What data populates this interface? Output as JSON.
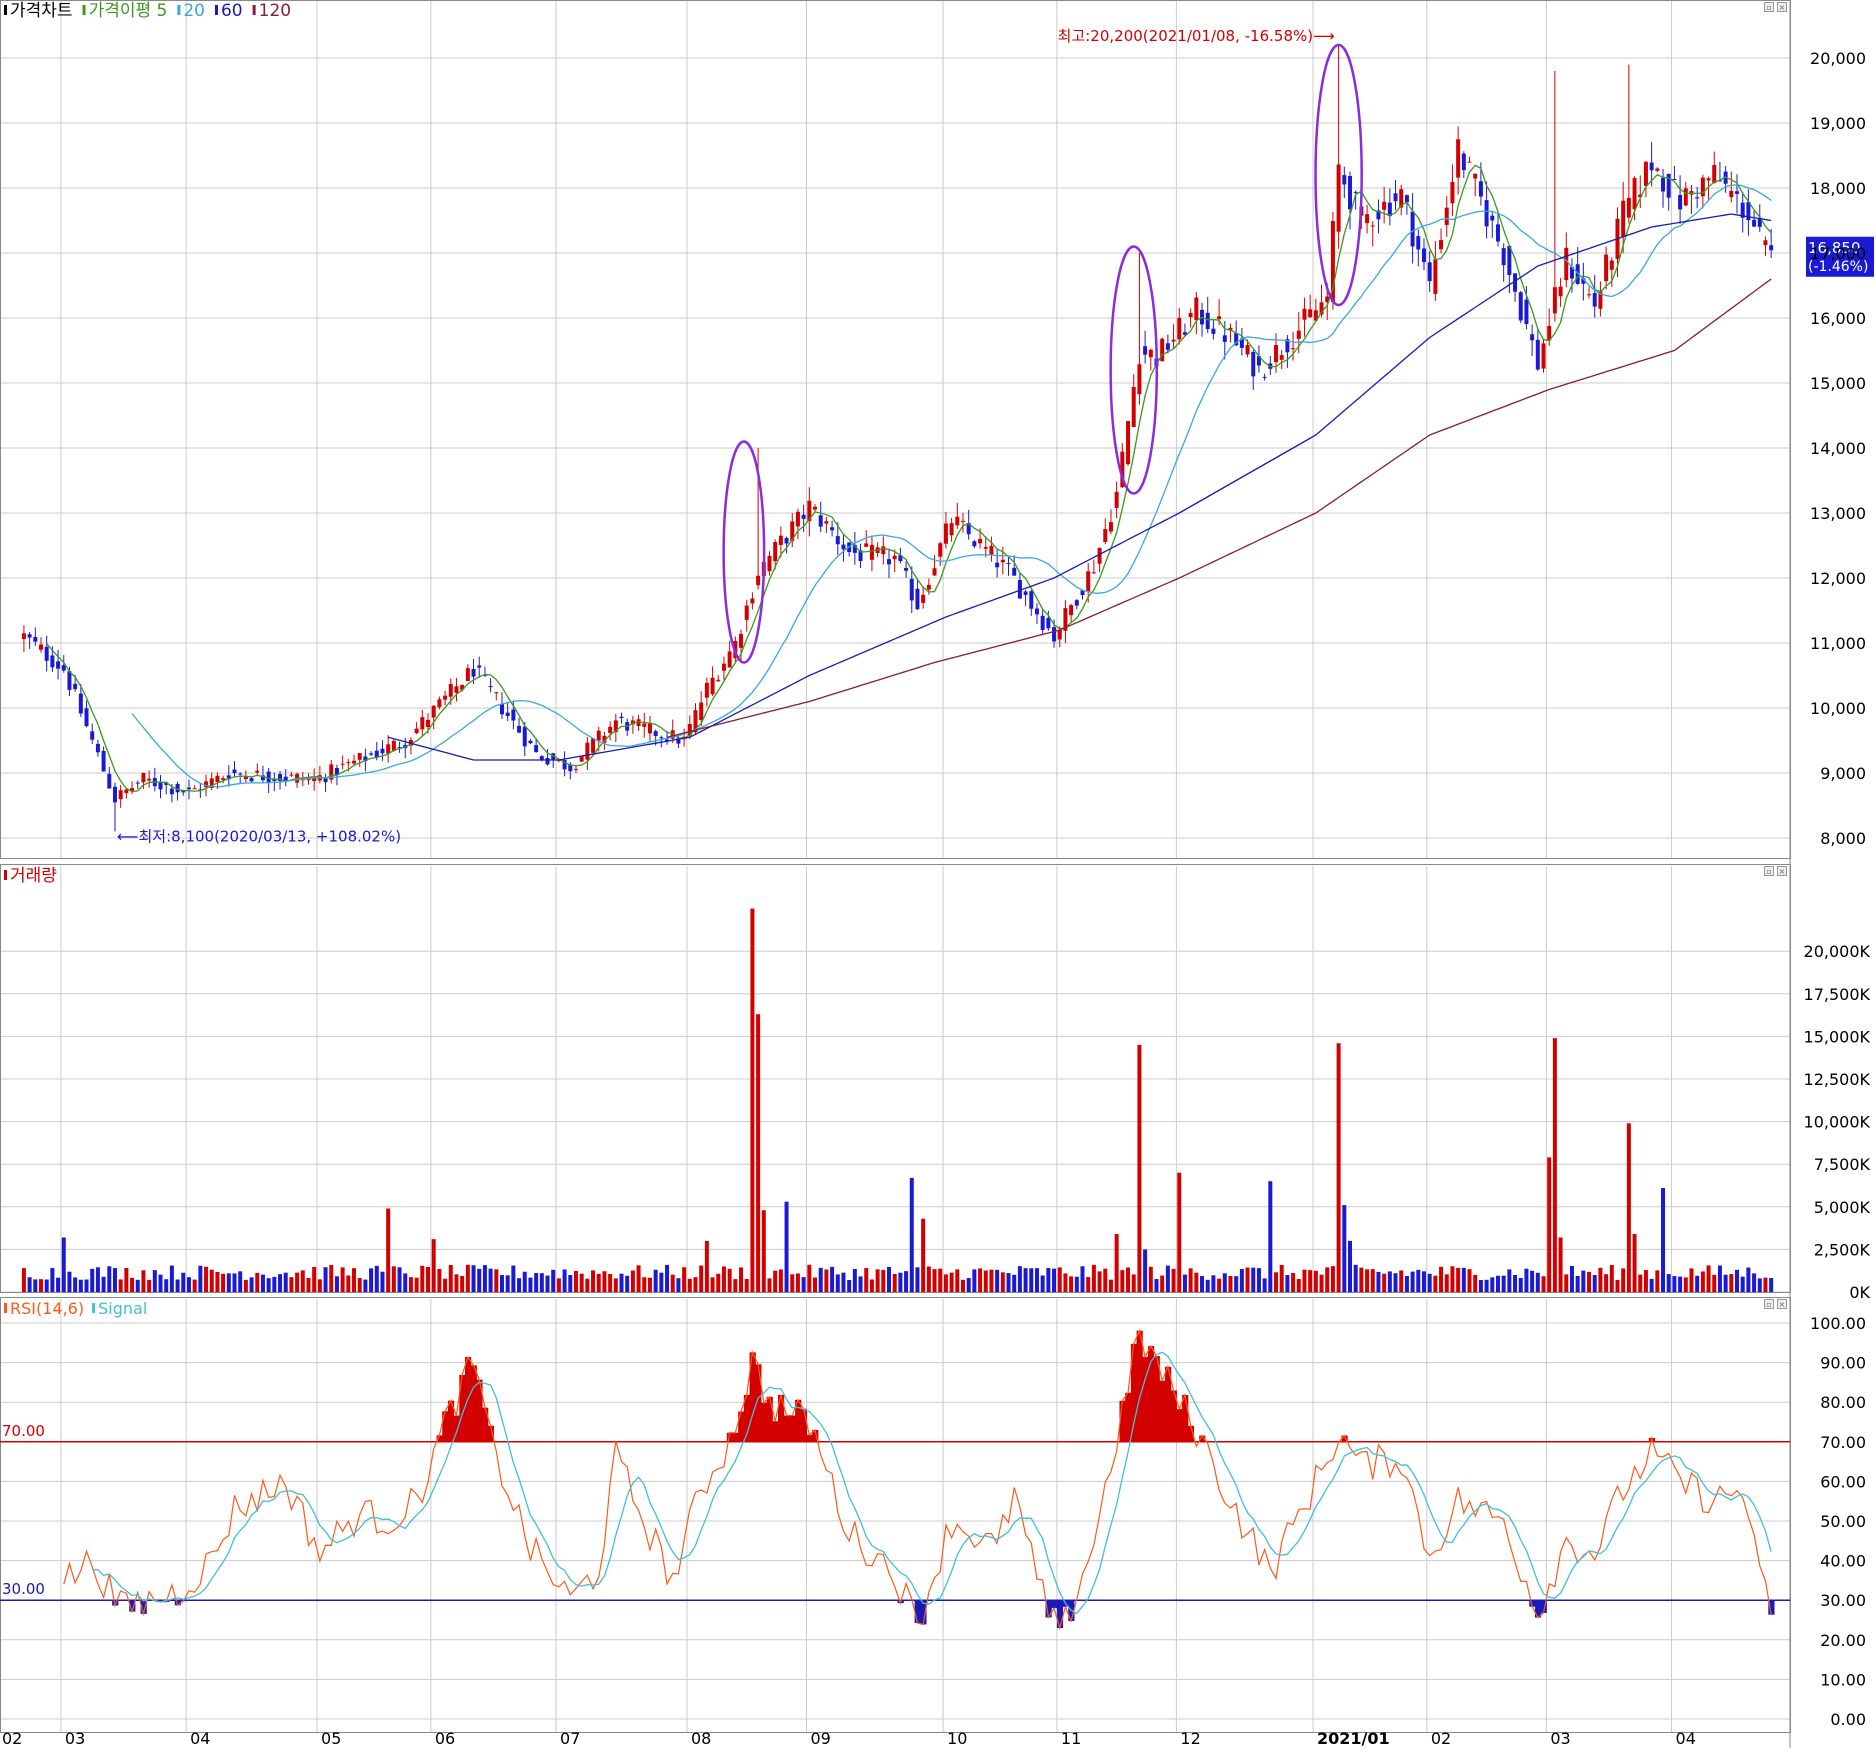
{
  "colors": {
    "up": "#d40000",
    "down": "#1a1ad4",
    "ma5": "#3a9a1a",
    "ma20": "#3aa8e0",
    "ma60": "#1a1ab8",
    "ma120": "#8a1a3a",
    "grid": "#cccccc",
    "rsi": "#ff5a1a",
    "signal": "#40c0d8",
    "highlight": "#8a2be2"
  },
  "price_panel": {
    "legend": [
      {
        "text": "가격차트",
        "color": "#000000"
      },
      {
        "text": "가격이평 5",
        "color": "#3a9a1a"
      },
      {
        "text": "20",
        "color": "#3aa8e0"
      },
      {
        "text": "60",
        "color": "#1a1ab8"
      },
      {
        "text": "120",
        "color": "#8a1a3a"
      }
    ],
    "high_label": "최고:20,200(2021/01/08, -16.58%)⟶",
    "low_label": "⟵최저:8,100(2020/03/13, +108.02%)",
    "current_price": "16,850",
    "current_change": "(-1.46%)"
  },
  "volume_panel": {
    "legend": "거래량"
  },
  "rsi_panel": {
    "legend_rsi": "RSI(14,6)",
    "legend_signal": "Signal",
    "level_70": "70.00",
    "level_30": "30.00"
  },
  "x_ticks": [
    "02",
    "03",
    "04",
    "05",
    "06",
    "07",
    "08",
    "09",
    "10",
    "11",
    "12",
    "2021/01",
    "02",
    "03",
    "04"
  ],
  "chart_data": [
    {
      "type": "candlestick",
      "title": "가격차트",
      "ylim": [
        8000,
        20000
      ],
      "yticks": [
        "20,000",
        "19,000",
        "18,000",
        "17,000",
        "16,000",
        "15,000",
        "14,000",
        "13,000",
        "12,000",
        "11,000",
        "10,000",
        "9,000",
        "8,000"
      ],
      "series_names": [
        "가격이평 5",
        "20",
        "60",
        "120"
      ],
      "anchor_closes": [
        {
          "date": "2020-02-20",
          "close": 11100
        },
        {
          "date": "2020-03-02",
          "close": 10600
        },
        {
          "date": "2020-03-13",
          "close": 8600
        },
        {
          "date": "2020-03-20",
          "close": 8900
        },
        {
          "date": "2020-04-01",
          "close": 8700
        },
        {
          "date": "2020-04-10",
          "close": 9000
        },
        {
          "date": "2020-05-01",
          "close": 8900
        },
        {
          "date": "2020-05-25",
          "close": 9500
        },
        {
          "date": "2020-06-10",
          "close": 10600
        },
        {
          "date": "2020-06-25",
          "close": 9300
        },
        {
          "date": "2020-07-03",
          "close": 9100
        },
        {
          "date": "2020-07-15",
          "close": 9800
        },
        {
          "date": "2020-07-31",
          "close": 9500
        },
        {
          "date": "2020-08-06",
          "close": 10300
        },
        {
          "date": "2020-08-13",
          "close": 11000
        },
        {
          "date": "2020-08-19",
          "close": 12100
        },
        {
          "date": "2020-09-01",
          "close": 13100
        },
        {
          "date": "2020-09-10",
          "close": 12400
        },
        {
          "date": "2020-09-22",
          "close": 12300
        },
        {
          "date": "2020-09-28",
          "close": 11600
        },
        {
          "date": "2020-10-06",
          "close": 12900
        },
        {
          "date": "2020-10-20",
          "close": 12100
        },
        {
          "date": "2020-10-30",
          "close": 11100
        },
        {
          "date": "2020-11-10",
          "close": 12200
        },
        {
          "date": "2020-11-16",
          "close": 13300
        },
        {
          "date": "2020-11-20",
          "close": 15500
        },
        {
          "date": "2020-11-25",
          "close": 15400
        },
        {
          "date": "2020-12-04",
          "close": 16100
        },
        {
          "date": "2020-12-14",
          "close": 15700
        },
        {
          "date": "2020-12-21",
          "close": 15200
        },
        {
          "date": "2021-01-06",
          "close": 16300
        },
        {
          "date": "2021-01-08",
          "close": 18300
        },
        {
          "date": "2021-01-14",
          "close": 17500
        },
        {
          "date": "2021-01-25",
          "close": 17900
        },
        {
          "date": "2021-02-01",
          "close": 16500
        },
        {
          "date": "2021-02-08",
          "close": 18600
        },
        {
          "date": "2021-02-18",
          "close": 17000
        },
        {
          "date": "2021-02-26",
          "close": 15300
        },
        {
          "date": "2021-03-05",
          "close": 16900
        },
        {
          "date": "2021-03-12",
          "close": 16200
        },
        {
          "date": "2021-03-19",
          "close": 17600
        },
        {
          "date": "2021-03-26",
          "close": 18400
        },
        {
          "date": "2021-04-02",
          "close": 17800
        },
        {
          "date": "2021-04-12",
          "close": 18200
        },
        {
          "date": "2021-04-20",
          "close": 17600
        },
        {
          "date": "2021-04-26",
          "close": 16850
        }
      ],
      "ma120_points": [
        {
          "date": "2020-07-28",
          "value": 9550
        },
        {
          "date": "2020-09-01",
          "value": 10100
        },
        {
          "date": "2020-10-01",
          "value": 10700
        },
        {
          "date": "2020-11-02",
          "value": 11200
        },
        {
          "date": "2020-12-01",
          "value": 12000
        },
        {
          "date": "2021-01-04",
          "value": 13000
        },
        {
          "date": "2021-02-01",
          "value": 14200
        },
        {
          "date": "2021-03-02",
          "value": 14900
        },
        {
          "date": "2021-04-01",
          "value": 15500
        },
        {
          "date": "2021-04-26",
          "value": 16600
        }
      ],
      "ma60_points": [
        {
          "date": "2020-05-20",
          "value": 9550
        },
        {
          "date": "2020-06-10",
          "value": 9200
        },
        {
          "date": "2020-07-01",
          "value": 9200
        },
        {
          "date": "2020-08-03",
          "value": 9550
        },
        {
          "date": "2020-09-01",
          "value": 10500
        },
        {
          "date": "2020-10-05",
          "value": 11400
        },
        {
          "date": "2020-10-30",
          "value": 12000
        },
        {
          "date": "2020-12-01",
          "value": 13000
        },
        {
          "date": "2021-01-04",
          "value": 14200
        },
        {
          "date": "2021-02-01",
          "value": 15700
        },
        {
          "date": "2021-02-26",
          "value": 16800
        },
        {
          "date": "2021-03-26",
          "value": 17400
        },
        {
          "date": "2021-04-15",
          "value": 17600
        },
        {
          "date": "2021-04-26",
          "value": 17500
        }
      ],
      "annotations": [
        {
          "text": "최고:20,200(2021/01/08, -16.58%)",
          "date": "2021-01-08",
          "value": 20200
        },
        {
          "text": "최저:8,100(2020/03/13, +108.02%)",
          "date": "2020-03-13",
          "value": 8100
        }
      ],
      "highlight_ellipses": [
        {
          "start": "2020-08-12",
          "end": "2020-08-19",
          "low": 10700,
          "high": 14100
        },
        {
          "start": "2020-11-16",
          "end": "2020-11-24",
          "low": 13300,
          "high": 17100
        },
        {
          "start": "2021-01-05",
          "end": "2021-01-13",
          "low": 16200,
          "high": 20200
        }
      ],
      "last": {
        "close": 16850,
        "change_pct": -1.46
      }
    },
    {
      "type": "bar",
      "title": "거래량",
      "ylim": [
        0,
        22500
      ],
      "yticks": [
        "20,000K",
        "17,500K",
        "15,000K",
        "12,500K",
        "10,000K",
        "7,500K",
        "5,000K",
        "2,500K",
        "0K"
      ],
      "spikes": [
        {
          "date": "2020-03-02",
          "value": 3200
        },
        {
          "date": "2020-05-20",
          "value": 4900
        },
        {
          "date": "2020-06-01",
          "value": 3100
        },
        {
          "date": "2020-08-06",
          "value": 3000
        },
        {
          "date": "2020-08-18",
          "value": 22500
        },
        {
          "date": "2020-08-19",
          "value": 16300
        },
        {
          "date": "2020-08-20",
          "value": 4800
        },
        {
          "date": "2020-08-26",
          "value": 5300
        },
        {
          "date": "2020-09-25",
          "value": 6700
        },
        {
          "date": "2020-09-29",
          "value": 4300
        },
        {
          "date": "2020-11-16",
          "value": 3400
        },
        {
          "date": "2020-11-20",
          "value": 14500
        },
        {
          "date": "2020-11-23",
          "value": 2500
        },
        {
          "date": "2020-12-01",
          "value": 7000
        },
        {
          "date": "2020-12-23",
          "value": 6500
        },
        {
          "date": "2021-01-08",
          "value": 14600
        },
        {
          "date": "2021-01-11",
          "value": 5100
        },
        {
          "date": "2021-01-12",
          "value": 3000
        },
        {
          "date": "2021-03-02",
          "value": 7900
        },
        {
          "date": "2021-03-03",
          "value": 14900
        },
        {
          "date": "2021-03-04",
          "value": 3200
        },
        {
          "date": "2021-03-22",
          "value": 9900
        },
        {
          "date": "2021-03-23",
          "value": 3400
        },
        {
          "date": "2021-03-30",
          "value": 6100
        }
      ],
      "baseline": "~700K–1,500K"
    },
    {
      "type": "line",
      "title": "RSI(14,6)",
      "ylim": [
        0,
        100
      ],
      "yticks": [
        "100.00",
        "90.00",
        "80.00",
        "70.00",
        "60.00",
        "50.00",
        "40.00",
        "30.00",
        "20.00",
        "10.00",
        "0.00"
      ],
      "levels": [
        70,
        30
      ],
      "series_names": [
        "RSI(14,6)",
        "Signal"
      ],
      "rsi_anchors": [
        {
          "date": "2020-03-02",
          "value": 35
        },
        {
          "date": "2020-03-09",
          "value": 40
        },
        {
          "date": "2020-03-16",
          "value": 28
        },
        {
          "date": "2020-03-23",
          "value": 30
        },
        {
          "date": "2020-03-30",
          "value": 32
        },
        {
          "date": "2020-04-07",
          "value": 40
        },
        {
          "date": "2020-04-13",
          "value": 53
        },
        {
          "date": "2020-04-24",
          "value": 60
        },
        {
          "date": "2020-05-04",
          "value": 42
        },
        {
          "date": "2020-05-13",
          "value": 52
        },
        {
          "date": "2020-05-20",
          "value": 50
        },
        {
          "date": "2020-05-27",
          "value": 55
        },
        {
          "date": "2020-06-04",
          "value": 78
        },
        {
          "date": "2020-06-10",
          "value": 90
        },
        {
          "date": "2020-06-15",
          "value": 70
        },
        {
          "date": "2020-06-24",
          "value": 43
        },
        {
          "date": "2020-07-03",
          "value": 30
        },
        {
          "date": "2020-07-10",
          "value": 38
        },
        {
          "date": "2020-07-15",
          "value": 66
        },
        {
          "date": "2020-07-22",
          "value": 50
        },
        {
          "date": "2020-07-29",
          "value": 35
        },
        {
          "date": "2020-08-05",
          "value": 58
        },
        {
          "date": "2020-08-12",
          "value": 70
        },
        {
          "date": "2020-08-18",
          "value": 90
        },
        {
          "date": "2020-08-21",
          "value": 80
        },
        {
          "date": "2020-09-01",
          "value": 75
        },
        {
          "date": "2020-09-10",
          "value": 47
        },
        {
          "date": "2020-09-22",
          "value": 37
        },
        {
          "date": "2020-09-28",
          "value": 24
        },
        {
          "date": "2020-10-06",
          "value": 50
        },
        {
          "date": "2020-10-16",
          "value": 43
        },
        {
          "date": "2020-10-21",
          "value": 57
        },
        {
          "date": "2020-10-27",
          "value": 35
        },
        {
          "date": "2020-11-02",
          "value": 20
        },
        {
          "date": "2020-11-10",
          "value": 45
        },
        {
          "date": "2020-11-16",
          "value": 71
        },
        {
          "date": "2020-11-20",
          "value": 97
        },
        {
          "date": "2020-11-27",
          "value": 85
        },
        {
          "date": "2020-12-04",
          "value": 73
        },
        {
          "date": "2020-12-14",
          "value": 55
        },
        {
          "date": "2020-12-23",
          "value": 37
        },
        {
          "date": "2021-01-04",
          "value": 60
        },
        {
          "date": "2021-01-08",
          "value": 72
        },
        {
          "date": "2021-01-14",
          "value": 64
        },
        {
          "date": "2021-01-25",
          "value": 66
        },
        {
          "date": "2021-02-01",
          "value": 41
        },
        {
          "date": "2021-02-08",
          "value": 55
        },
        {
          "date": "2021-02-18",
          "value": 50
        },
        {
          "date": "2021-02-26",
          "value": 27
        },
        {
          "date": "2021-03-05",
          "value": 45
        },
        {
          "date": "2021-03-12",
          "value": 42
        },
        {
          "date": "2021-03-19",
          "value": 58
        },
        {
          "date": "2021-03-26",
          "value": 67
        },
        {
          "date": "2021-04-02",
          "value": 60
        },
        {
          "date": "2021-04-12",
          "value": 55
        },
        {
          "date": "2021-04-19",
          "value": 58
        },
        {
          "date": "2021-04-22",
          "value": 35
        },
        {
          "date": "2021-04-26",
          "value": 29
        }
      ]
    }
  ]
}
